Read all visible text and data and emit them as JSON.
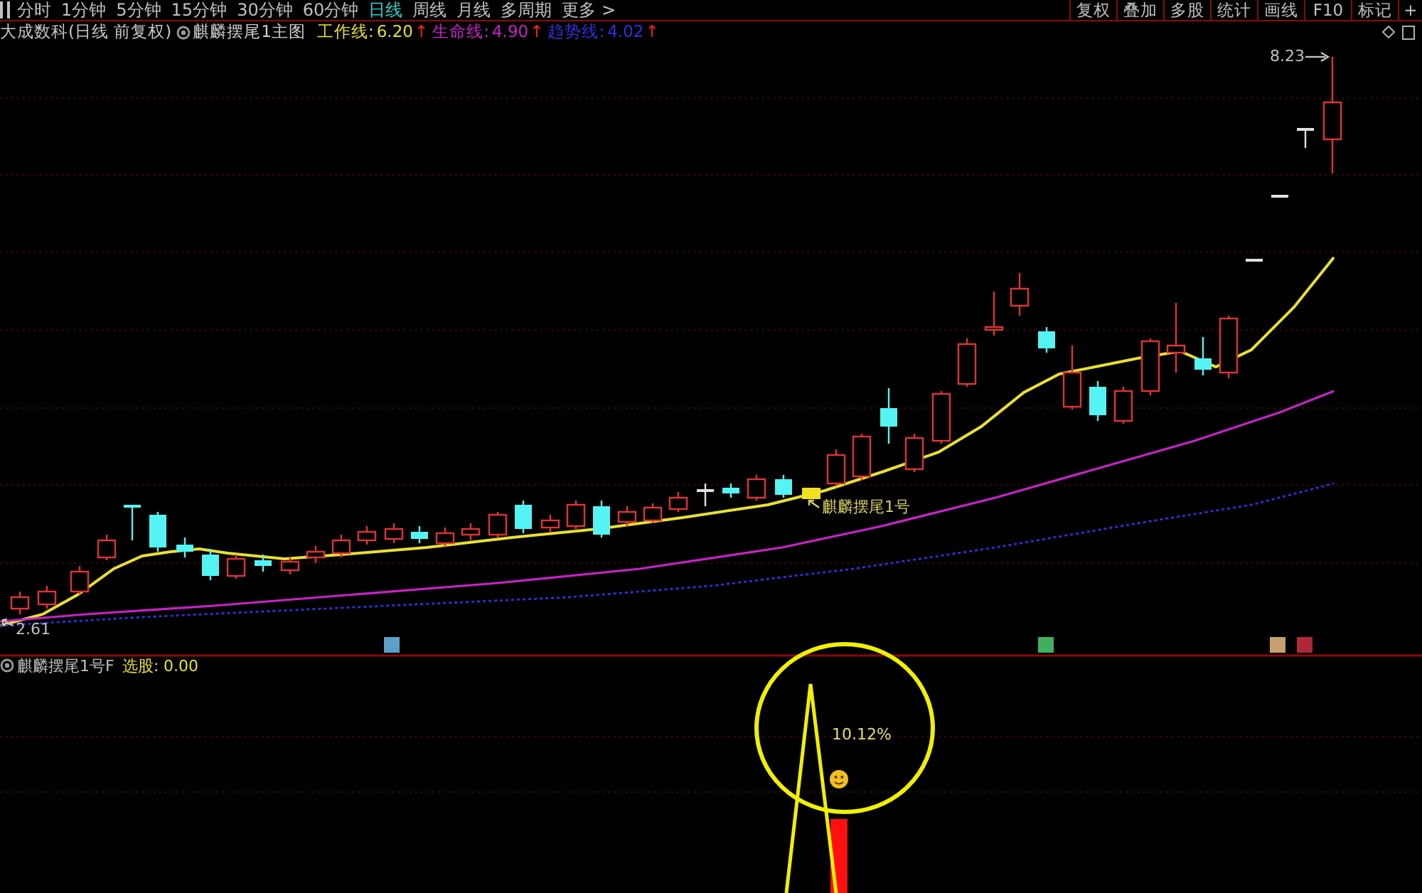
{
  "toolbar": {
    "periods": [
      {
        "label": "分时",
        "selected": false
      },
      {
        "label": "1分钟",
        "selected": false
      },
      {
        "label": "5分钟",
        "selected": false
      },
      {
        "label": "15分钟",
        "selected": false
      },
      {
        "label": "30分钟",
        "selected": false
      },
      {
        "label": "60分钟",
        "selected": false
      },
      {
        "label": "日线",
        "selected": true
      },
      {
        "label": "周线",
        "selected": false
      },
      {
        "label": "月线",
        "selected": false
      },
      {
        "label": "多周期",
        "selected": false
      },
      {
        "label": "更多 >",
        "selected": false
      }
    ],
    "tools": [
      "复权",
      "叠加",
      "多股",
      "统计",
      "画线",
      "F10",
      "标记",
      "+"
    ]
  },
  "legend": {
    "stock": "大成数科(日线 前复权)",
    "indicator": "麒麟摆尾1主图",
    "lines": [
      {
        "name": "工作线:",
        "value": "6.20",
        "arrow": "↑",
        "color": "#e8e030"
      },
      {
        "name": "生命线:",
        "value": "4.90",
        "arrow": "↑",
        "color": "#c822c8"
      },
      {
        "name": "趋势线:",
        "value": "4.02",
        "arrow": "↑",
        "color": "#3030e0"
      }
    ]
  },
  "main_chart": {
    "high_label": "8.23",
    "low_label": "2.61",
    "signal_label": "麒麟摆尾1号",
    "event_markers": [
      {
        "color": "#5aa0c8"
      },
      {
        "color": "#40b060"
      },
      {
        "color": "#c8a070"
      },
      {
        "color": "#b02838"
      }
    ]
  },
  "sub_chart": {
    "indicator": "麒麟摆尾1号F",
    "readings": [
      {
        "label": "选股:",
        "value": "0.00"
      }
    ],
    "callout": "10.12%"
  }
}
